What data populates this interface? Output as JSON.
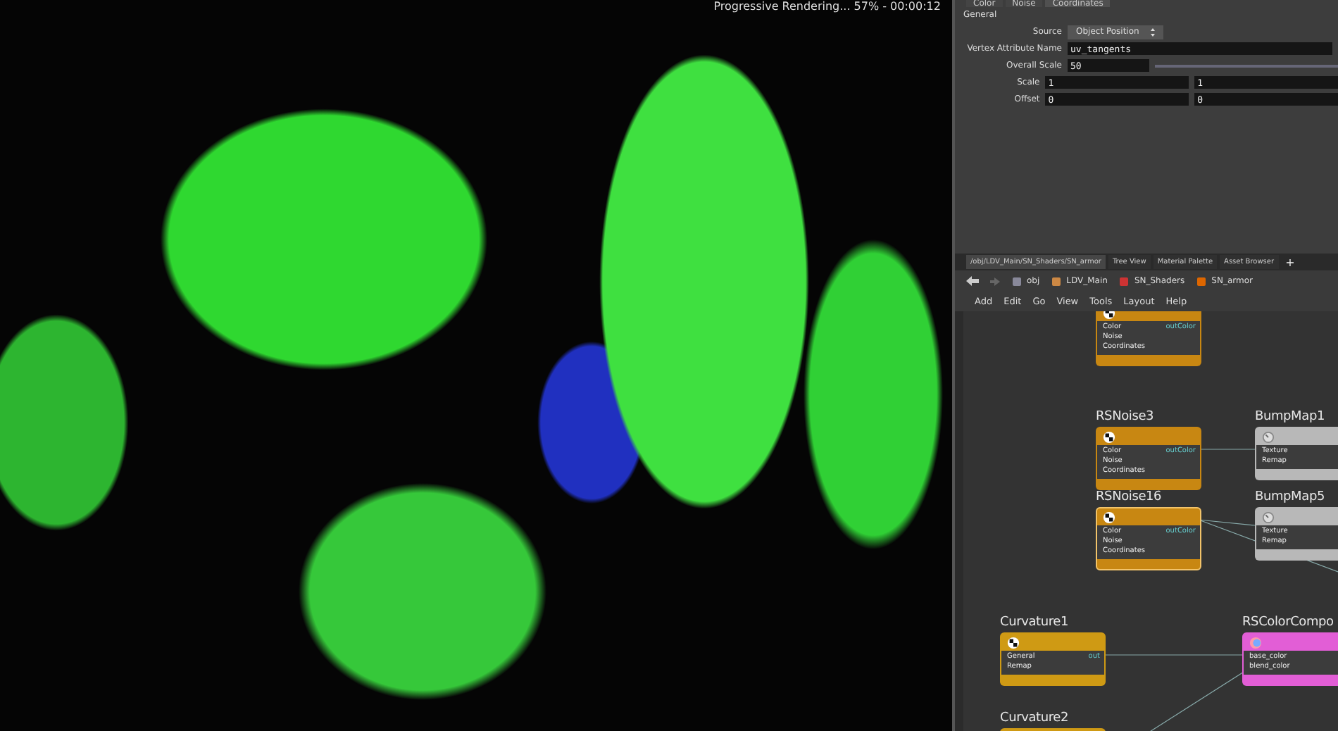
{
  "viewport": {
    "status": "Progressive Rendering... 57% - 00:00:12"
  },
  "parameters": {
    "tabs": [
      {
        "label": "Color",
        "selected": false
      },
      {
        "label": "Noise",
        "selected": false
      },
      {
        "label": "Coordinates",
        "selected": true
      }
    ],
    "section": "General",
    "rows": [
      {
        "kind": "dropdown",
        "label": "Source",
        "value": "Object Position"
      },
      {
        "kind": "text",
        "label": "Vertex Attribute Name",
        "value": "uv_tangents"
      },
      {
        "kind": "slider",
        "label": "Overall Scale",
        "value": "50"
      },
      {
        "kind": "vector",
        "label": "Scale",
        "values": [
          "1",
          "1"
        ]
      },
      {
        "kind": "vector",
        "label": "Offset",
        "values": [
          "0",
          "0"
        ]
      }
    ]
  },
  "network": {
    "tabs": [
      {
        "label": "/obj/LDV_Main/SN_Shaders/SN_armor",
        "selected": true
      },
      {
        "label": "Tree View",
        "selected": false
      },
      {
        "label": "Material Palette",
        "selected": false
      },
      {
        "label": "Asset Browser",
        "selected": false
      }
    ],
    "add_tab": "+",
    "path": [
      "obj",
      "LDV_Main",
      "SN_Shaders",
      "SN_armor"
    ],
    "menu": [
      "Add",
      "Edit",
      "Go",
      "View",
      "Tools",
      "Layout",
      "Help"
    ],
    "nodes": [
      {
        "kind": "noise",
        "selected": false,
        "inputs": [
          "Color",
          "Noise",
          "Coordinates"
        ],
        "output": "outColor"
      },
      {
        "kind": "noise",
        "title": "RSNoise3",
        "selected": false,
        "inputs": [
          "Color",
          "Noise",
          "Coordinates"
        ],
        "output": "outColor"
      },
      {
        "kind": "noise",
        "title": "RSNoise16",
        "selected": true,
        "inputs": [
          "Color",
          "Noise",
          "Coordinates"
        ],
        "output": "outColor"
      },
      {
        "kind": "bump",
        "title": "BumpMap1",
        "selected": false,
        "inputs": [
          "Texture",
          "Remap"
        ]
      },
      {
        "kind": "bump",
        "title": "BumpMap5",
        "selected": false,
        "inputs": [
          "Texture",
          "Remap"
        ]
      },
      {
        "kind": "curvature",
        "title": "Curvature1",
        "selected": false,
        "inputs": [
          "General",
          "Remap"
        ],
        "output": "out"
      },
      {
        "kind": "composite",
        "title": "RSColorCompo",
        "selected": false,
        "inputs": [
          "base_color",
          "blend_color"
        ]
      },
      {
        "kind": "curvature",
        "title": "Curvature2",
        "selected": false
      }
    ]
  }
}
